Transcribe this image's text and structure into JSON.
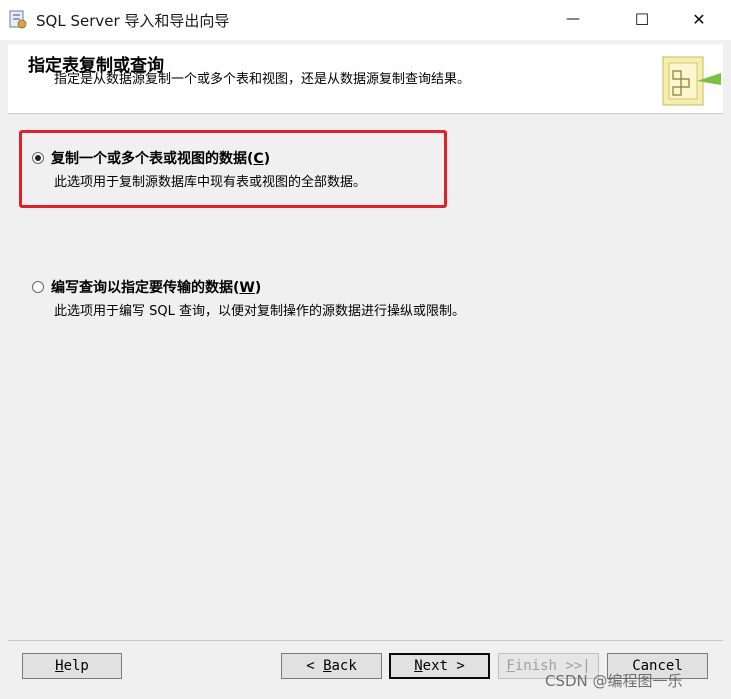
{
  "window": {
    "title": "SQL Server 导入和导出向导",
    "minimize_glyph": "—",
    "maximize_glyph": "☐",
    "close_glyph": "✕"
  },
  "header": {
    "title": "指定表复制或查询",
    "subtitle": "指定是从数据源复制一个或多个表和视图，还是从数据源复制查询结果。",
    "graphic_icon": "wizard-folder-icon"
  },
  "options": [
    {
      "label": "复制一个或多个表或视图的数据",
      "accel": "C",
      "description": "此选项用于复制源数据库中现有表或视图的全部数据。",
      "checked": true
    },
    {
      "label": "编写查询以指定要传输的数据",
      "accel": "W",
      "description": "此选项用于编写 SQL 查询，以便对复制操作的源数据进行操纵或限制。",
      "checked": false
    }
  ],
  "buttons": {
    "help": {
      "accel": "H",
      "rest": "elp"
    },
    "back": {
      "prefix": "< ",
      "accel": "B",
      "rest": "ack"
    },
    "next": {
      "accel": "N",
      "rest": "ext",
      "suffix": " >"
    },
    "finish": {
      "accel": "F",
      "rest": "inish",
      "suffix": " >>|"
    },
    "cancel": {
      "label": "Cancel"
    }
  },
  "watermark": "CSDN @编程图一乐",
  "colors": {
    "highlight": "#e0202a",
    "accent": "#7ac143"
  }
}
